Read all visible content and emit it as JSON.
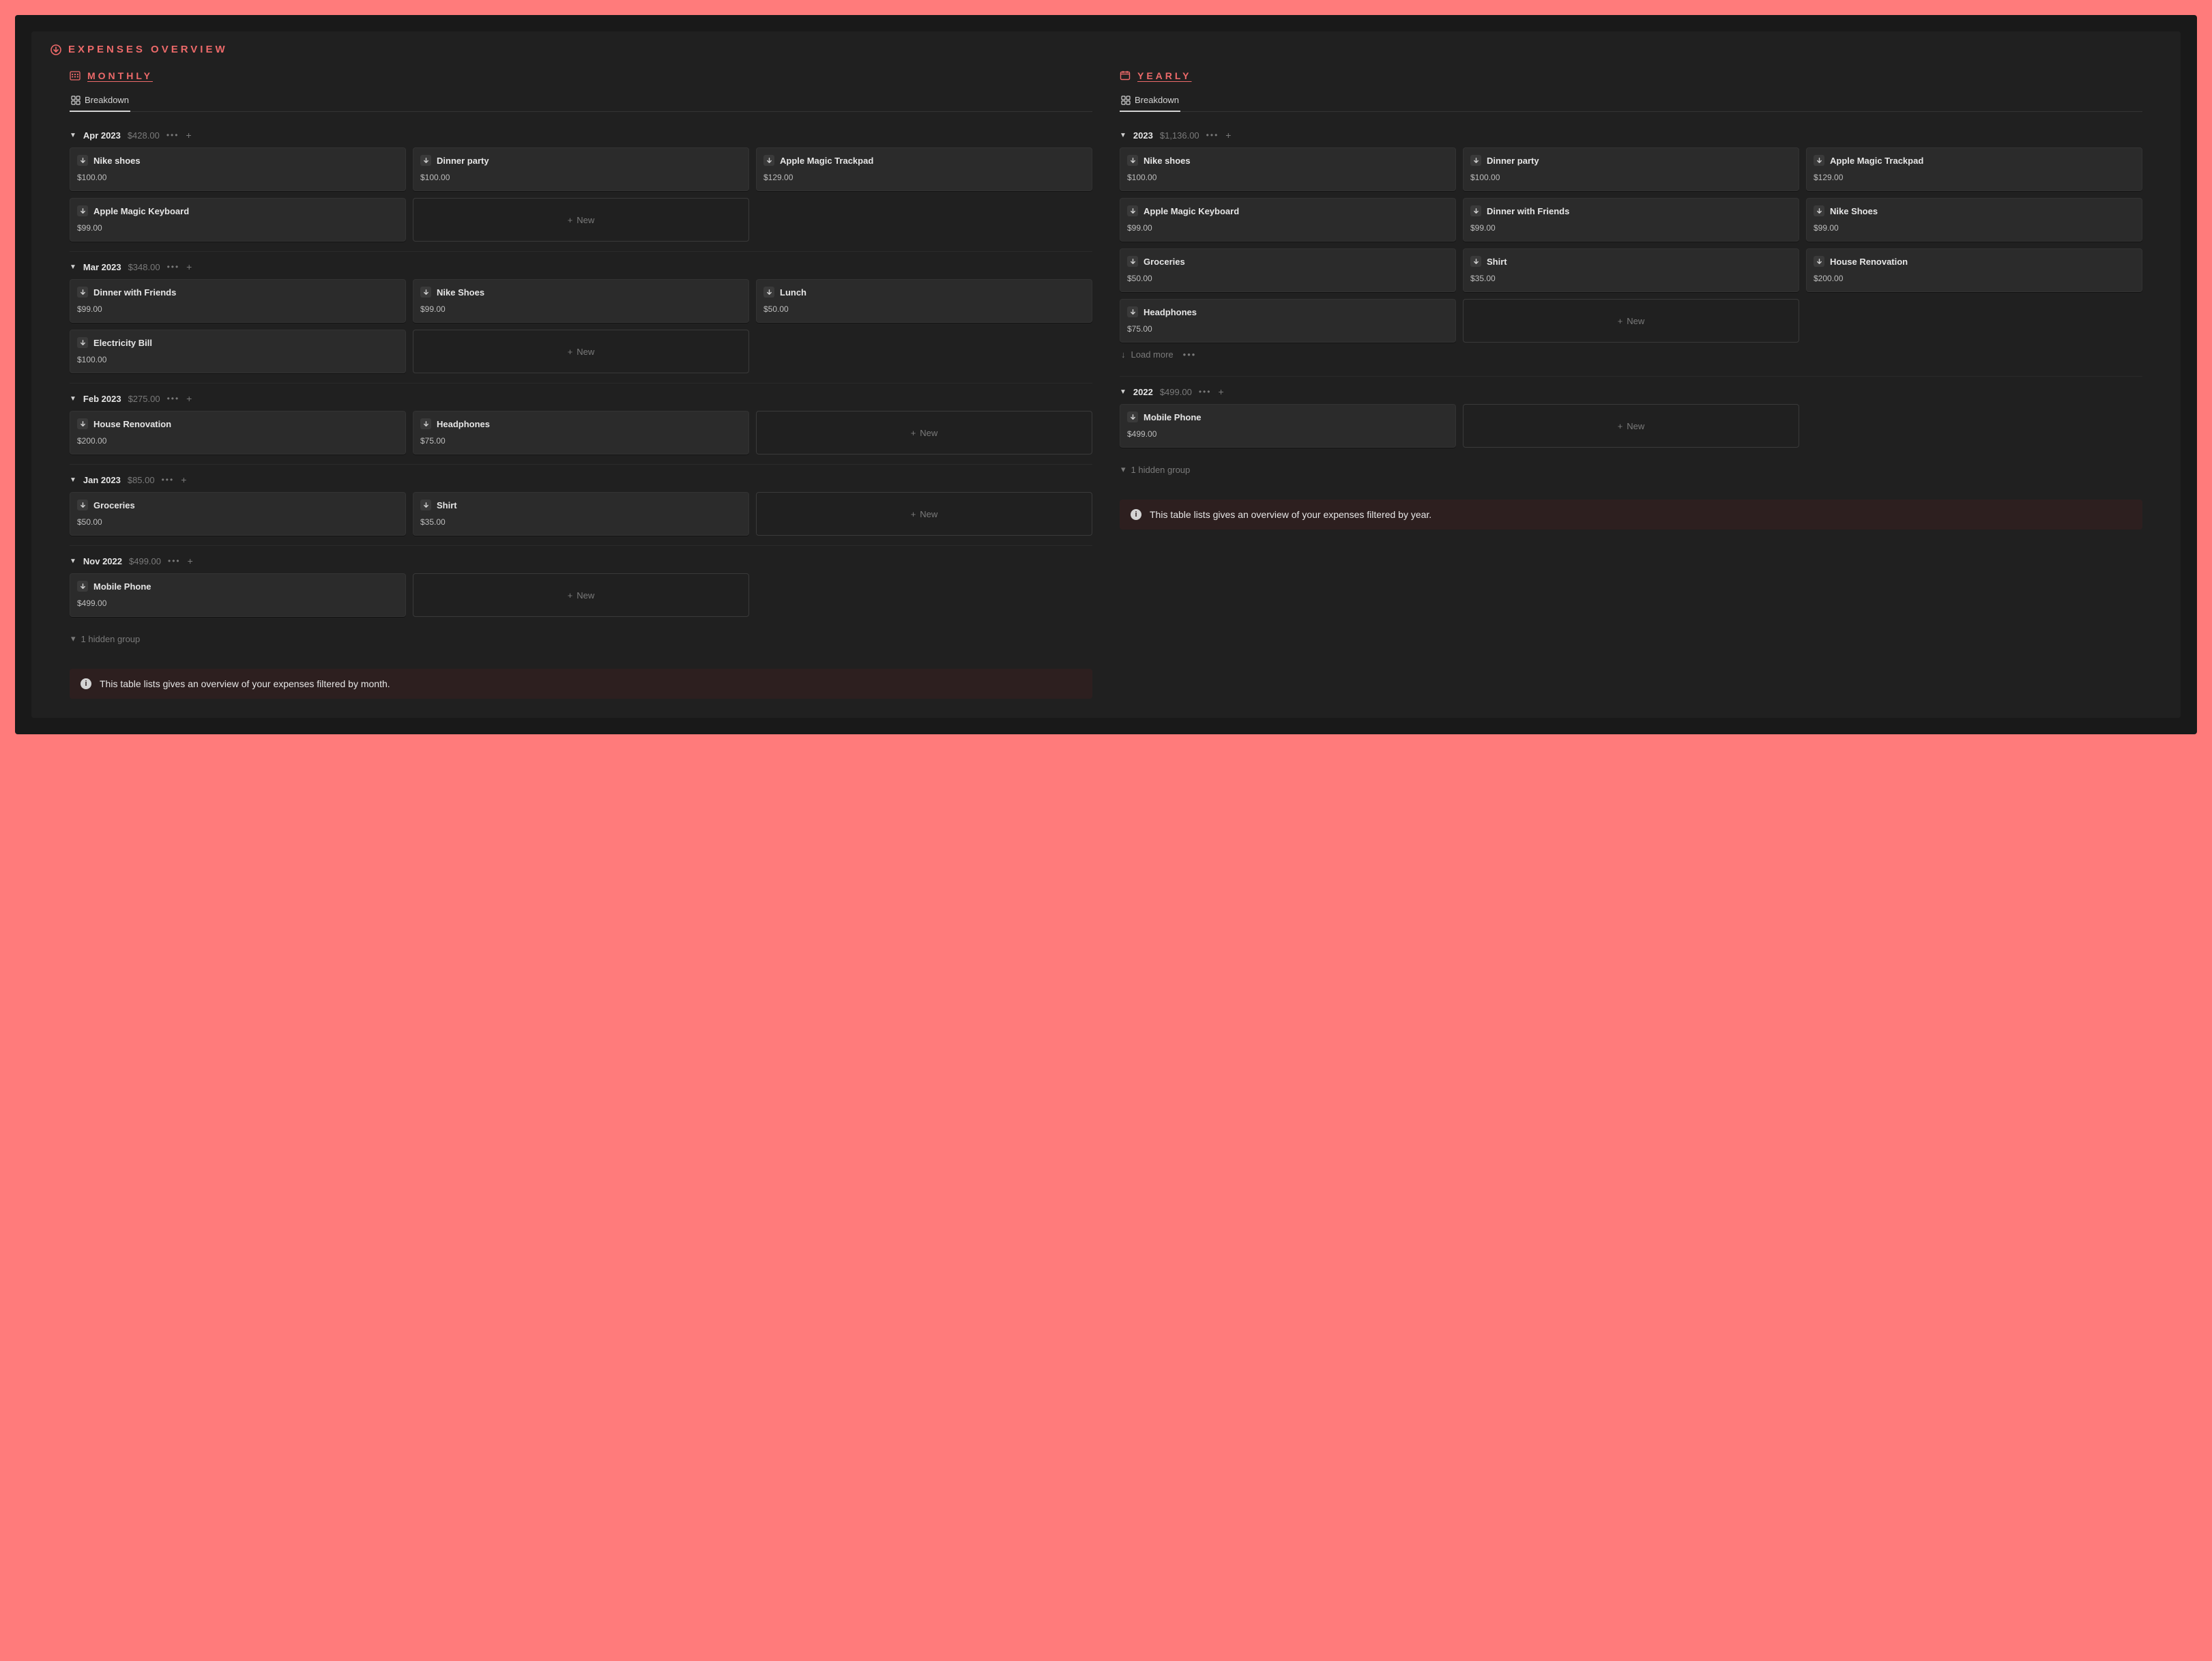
{
  "page": {
    "title": "EXPENSES OVERVIEW"
  },
  "monthly": {
    "heading": "MONTHLY",
    "tab": "Breakdown",
    "new_label": "New",
    "hidden_group": "1 hidden group",
    "info": "This table lists gives an overview of your expenses filtered by month.",
    "groups": [
      {
        "label": "Apr 2023",
        "total": "$428.00",
        "items": [
          {
            "name": "Nike shoes",
            "amount": "$100.00"
          },
          {
            "name": "Dinner party",
            "amount": "$100.00"
          },
          {
            "name": "Apple Magic Trackpad",
            "amount": "$129.00"
          },
          {
            "name": "Apple Magic Keyboard",
            "amount": "$99.00"
          }
        ]
      },
      {
        "label": "Mar 2023",
        "total": "$348.00",
        "items": [
          {
            "name": "Dinner with Friends",
            "amount": "$99.00"
          },
          {
            "name": "Nike Shoes",
            "amount": "$99.00"
          },
          {
            "name": "Lunch",
            "amount": "$50.00"
          },
          {
            "name": "Electricity Bill",
            "amount": "$100.00"
          }
        ]
      },
      {
        "label": "Feb 2023",
        "total": "$275.00",
        "items": [
          {
            "name": "House Renovation",
            "amount": "$200.00"
          },
          {
            "name": "Headphones",
            "amount": "$75.00"
          }
        ]
      },
      {
        "label": "Jan 2023",
        "total": "$85.00",
        "items": [
          {
            "name": "Groceries",
            "amount": "$50.00"
          },
          {
            "name": "Shirt",
            "amount": "$35.00"
          }
        ]
      },
      {
        "label": "Nov 2022",
        "total": "$499.00",
        "items": [
          {
            "name": "Mobile Phone",
            "amount": "$499.00"
          }
        ]
      }
    ]
  },
  "yearly": {
    "heading": "YEARLY",
    "tab": "Breakdown",
    "new_label": "New",
    "load_more": "Load more",
    "hidden_group": "1 hidden group",
    "info": "This table lists gives an overview of your expenses filtered by year.",
    "groups": [
      {
        "label": "2023",
        "total": "$1,136.00",
        "items": [
          {
            "name": "Nike shoes",
            "amount": "$100.00"
          },
          {
            "name": "Dinner party",
            "amount": "$100.00"
          },
          {
            "name": "Apple Magic Trackpad",
            "amount": "$129.00"
          },
          {
            "name": "Apple Magic Keyboard",
            "amount": "$99.00"
          },
          {
            "name": "Dinner with Friends",
            "amount": "$99.00"
          },
          {
            "name": "Nike Shoes",
            "amount": "$99.00"
          },
          {
            "name": "Groceries",
            "amount": "$50.00"
          },
          {
            "name": "Shirt",
            "amount": "$35.00"
          },
          {
            "name": "House Renovation",
            "amount": "$200.00"
          },
          {
            "name": "Headphones",
            "amount": "$75.00"
          }
        ],
        "has_load_more": true
      },
      {
        "label": "2022",
        "total": "$499.00",
        "items": [
          {
            "name": "Mobile Phone",
            "amount": "$499.00"
          }
        ]
      }
    ]
  }
}
